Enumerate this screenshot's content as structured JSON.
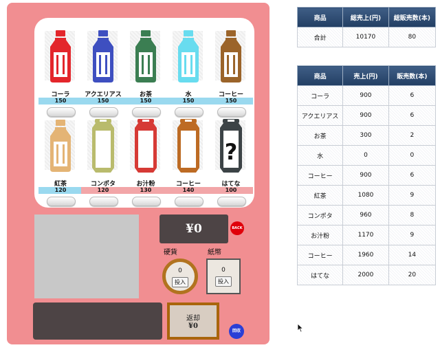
{
  "machine": {
    "products": [
      {
        "name": "コーラ",
        "price": "150",
        "price_color": "blue",
        "kind": "bottle",
        "color": "#e3262b"
      },
      {
        "name": "アクエリアス",
        "price": "150",
        "price_color": "blue",
        "kind": "bottle",
        "color": "#3e4fc0"
      },
      {
        "name": "お茶",
        "price": "150",
        "price_color": "blue",
        "kind": "bottle",
        "color": "#3b7e52"
      },
      {
        "name": "水",
        "price": "150",
        "price_color": "blue",
        "kind": "bottle",
        "color": "#68dcef"
      },
      {
        "name": "コーヒー",
        "price": "150",
        "price_color": "blue",
        "kind": "bottle",
        "color": "#9b642a"
      },
      {
        "name": "紅茶",
        "price": "120",
        "price_color": "blue",
        "kind": "bottle",
        "color": "#e4b475"
      },
      {
        "name": "コンポタ",
        "price": "120",
        "price_color": "pink",
        "kind": "can",
        "color": "#b9bb6d"
      },
      {
        "name": "お汁粉",
        "price": "130",
        "price_color": "pink",
        "kind": "can",
        "color": "#d63a35"
      },
      {
        "name": "コーヒー",
        "price": "140",
        "price_color": "pink",
        "kind": "can",
        "color": "#bd6b24"
      },
      {
        "name": "はてな",
        "price": "100",
        "price_color": "pink",
        "kind": "mystery",
        "color": "#3c4346"
      }
    ],
    "amount_display": "¥0",
    "back_label": "BACK",
    "coin_label": "硬貨",
    "bill_label": "紙幣",
    "coin_count": "0",
    "bill_count": "0",
    "insert_label": "投入",
    "refund_label": "返却",
    "refund_amount": "¥0",
    "collect_label": "回収"
  },
  "summary": {
    "headers": [
      "商品",
      "総売上(円)",
      "総販売数(本)"
    ],
    "rows": [
      [
        "合計",
        "10170",
        "80"
      ]
    ]
  },
  "detail": {
    "headers": [
      "商品",
      "売上(円)",
      "販売数(本)"
    ],
    "rows": [
      [
        "コーラ",
        "900",
        "6"
      ],
      [
        "アクエリアス",
        "900",
        "6"
      ],
      [
        "お茶",
        "300",
        "2"
      ],
      [
        "水",
        "0",
        "0"
      ],
      [
        "コーヒー",
        "900",
        "6"
      ],
      [
        "紅茶",
        "1080",
        "9"
      ],
      [
        "コンポタ",
        "960",
        "8"
      ],
      [
        "お汁粉",
        "1170",
        "9"
      ],
      [
        "コーヒー",
        "1960",
        "14"
      ],
      [
        "はてな",
        "2000",
        "20"
      ]
    ]
  }
}
